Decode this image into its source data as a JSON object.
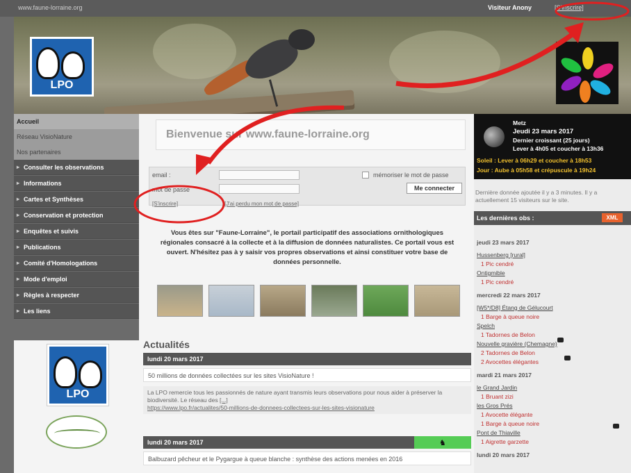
{
  "top_bar": {
    "site_url": "www.faune-lorraine.org",
    "visitor": "Visiteur Anony",
    "join_link": "[S'inscrire]"
  },
  "banner": {
    "logo_text": "LPO"
  },
  "sidebar": {
    "home": "Accueil",
    "network": "Réseau VisioNature",
    "partners": "Nos partenaires",
    "items": [
      {
        "label": "Consulter les observations"
      },
      {
        "label": "Informations"
      },
      {
        "label": "Cartes et Synthèses"
      },
      {
        "label": "Conservation et protection"
      },
      {
        "label": "Enquêtes et suivis"
      },
      {
        "label": "Publications"
      },
      {
        "label": "Comité d'Homologations"
      },
      {
        "label": "Mode d'emploi"
      },
      {
        "label": "Règles à respecter"
      },
      {
        "label": "Les liens"
      }
    ],
    "logo_text": "LPO"
  },
  "main": {
    "welcome_title": "Bienvenue sur www.faune-lorraine.org",
    "login": {
      "email_label": "email :",
      "password_label": "mot de passe",
      "remember_label": "mémoriser le mot de passe",
      "connect_button": "Me connecter",
      "join_link": "[S'inscrire]",
      "forgot_link": "[J'ai perdu mon mot de passe]"
    },
    "intro": "Vous êtes sur \"Faune-Lorraine\", le portail participatif des associations ornithologiques régionales consacré à la collecte et à la diffusion de données naturalistes. Ce portail vous est ouvert. N'hésitez pas à y saisir vos propres observations et ainsi constituer votre base de données personnelle.",
    "news_title": "Actualités",
    "news": [
      {
        "date": "lundi 20 mars 2017",
        "headline": "50 millions de données collectées sur les sites VisioNature !",
        "body": "La LPO remercie tous les passionnés de nature ayant transmis leurs observations pour nous aider à préserver la biodiversité. Le réseau des",
        "more": "[...]",
        "link": "https://www.lpo.fr/actualites/50-millions-de-donnees-collectees-sur-les-sites-visionature"
      },
      {
        "date": "lundi 20 mars 2017",
        "headline": "Balbuzard pêcheur et le Pygargue à queue blanche : synthèse des actions menées en 2016"
      }
    ]
  },
  "right": {
    "city": "Metz",
    "date": "Jeudi 23 mars 2017",
    "moon_phase": "Dernier croissant (25 jours)",
    "moon_times": "Lever à 4h05 et coucher à 13h36",
    "sun": "Soleil : Lever à 06h29 et coucher à 18h53",
    "day": "Jour : Aube à 05h58 et crépuscule à 19h24",
    "last_data": "Dernière donnée ajoutée il y a 3 minutes. Il y a actuellement 15 visiteurs sur le site.",
    "obs_header": "Les dernières obs :",
    "xml": "XML",
    "observations": [
      {
        "type": "date",
        "text": "jeudi 23 mars 2017"
      },
      {
        "type": "place",
        "text": "Hussenberg [rural]"
      },
      {
        "type": "species",
        "text": "1 Pic cendré"
      },
      {
        "type": "place",
        "text": "Ontigmible"
      },
      {
        "type": "species",
        "text": "1 Pic cendré"
      },
      {
        "type": "date",
        "text": "mercredi 22 mars 2017"
      },
      {
        "type": "place",
        "text": "[W5*/D8] Étang de Gélucourt"
      },
      {
        "type": "species",
        "text": "1 Barge à queue noire"
      },
      {
        "type": "place",
        "text": "Spelch"
      },
      {
        "type": "species",
        "text": "1 Tadornes de Belon"
      },
      {
        "type": "place",
        "text": "Nouvelle gravière (Chemagne)"
      },
      {
        "type": "species",
        "text": "2 Tadornes de Belon"
      },
      {
        "type": "species",
        "text": "2 Avocettes élégantes"
      },
      {
        "type": "date",
        "text": "mardi 21 mars 2017"
      },
      {
        "type": "place",
        "text": "le Grand Jardin"
      },
      {
        "type": "species",
        "text": "1 Bruant zizi"
      },
      {
        "type": "place",
        "text": "les Gros Prés"
      },
      {
        "type": "species",
        "text": "1 Avocette élégante"
      },
      {
        "type": "species",
        "text": "1 Barge à queue noire"
      },
      {
        "type": "place",
        "text": "Pont de Thiaville"
      },
      {
        "type": "species",
        "text": "1 Aigrette garzette"
      },
      {
        "type": "date",
        "text": "lundi 20 mars 2017"
      }
    ]
  },
  "colors": {
    "annotation": "#e02020",
    "nav_bg": "#555555",
    "xml_badge": "#e8622d"
  }
}
